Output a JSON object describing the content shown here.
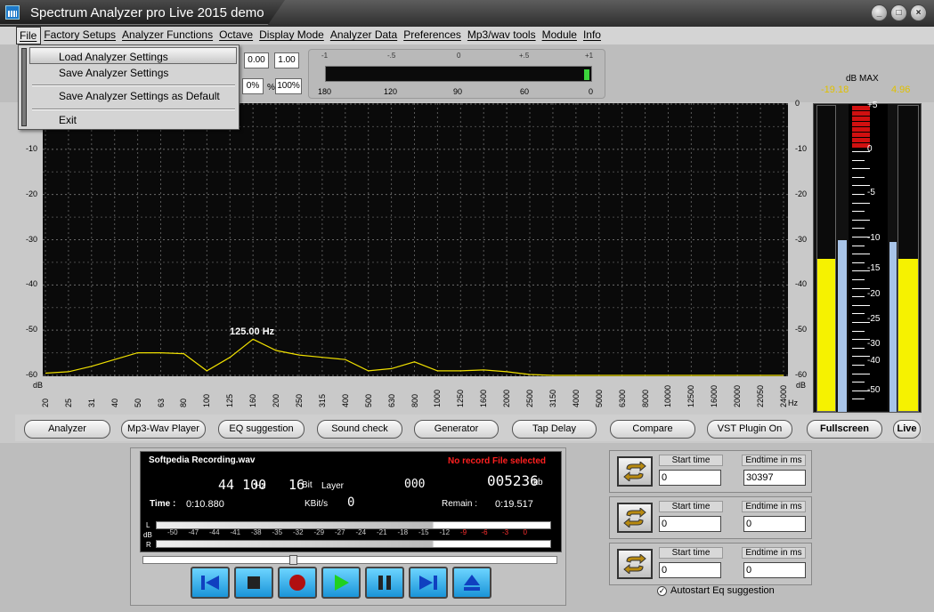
{
  "window": {
    "title": "Spectrum Analyzer pro Live 2015 demo",
    "buttons": [
      "_",
      "□",
      "×"
    ]
  },
  "menu": [
    "File",
    "Factory Setups",
    "Analyzer Functions",
    "Octave",
    "Display Mode",
    "Analyzer Data",
    "Preferences",
    "Mp3/wav tools",
    "Module",
    "Info"
  ],
  "file_menu": {
    "items": [
      "Load Analyzer Settings",
      "Save Analyzer Settings",
      "Save Analyzer Settings as Default",
      "Exit"
    ]
  },
  "toolbar": {
    "val_a": "0.00",
    "val_b": "1.00",
    "pct_a": "0%",
    "pct_sep": "%",
    "pct_b": "100%",
    "hmeter_ticks": [
      "-1",
      "-.5",
      "0",
      "+.5",
      "+1"
    ],
    "hmeter_labels": [
      "180",
      "120",
      "90",
      "60",
      "0"
    ],
    "hmeter_level": 0.98
  },
  "dbmax": {
    "label": "dB MAX",
    "left": "-19.18",
    "right": "4.96"
  },
  "chart_data": {
    "type": "line",
    "ylabel": "dB",
    "xlabel": "Hz",
    "ylim": [
      -60,
      0
    ],
    "yticks": [
      "0",
      "-10",
      "-20",
      "-30",
      "-40",
      "-50",
      "-60"
    ],
    "x": [
      "20",
      "25",
      "31",
      "40",
      "50",
      "63",
      "80",
      "100",
      "125",
      "160",
      "200",
      "250",
      "315",
      "400",
      "500",
      "630",
      "800",
      "1000",
      "1250",
      "1600",
      "2000",
      "2500",
      "3150",
      "4000",
      "5000",
      "6300",
      "8000",
      "10000",
      "12500",
      "16000",
      "20000",
      "22050",
      "24000"
    ],
    "series": [
      {
        "values": [
          -59.5,
          -59.2,
          -58,
          -56.5,
          -55,
          -55,
          -55.2,
          -59,
          -56,
          -52,
          -54.5,
          -55.5,
          -56,
          -56.5,
          -59,
          -58.5,
          -57,
          -59,
          -59,
          -58.8,
          -59.2,
          -59.8,
          -60,
          -60,
          -60,
          -60,
          -60,
          -60,
          -60,
          -60,
          -60,
          -60,
          -60
        ]
      }
    ],
    "peak_label": "125.00 Hz",
    "grid": true
  },
  "vu": {
    "scale": [
      "+5",
      "0",
      "-5",
      "-10",
      "-15",
      "-20",
      "-25",
      "-30",
      "-40",
      "-50"
    ],
    "left_level": 0.5,
    "left_peak": 0.6,
    "right_level": 0.5,
    "right_peak": 0.6
  },
  "module_buttons": [
    "Analyzer",
    "Mp3-Wav Player",
    "EQ suggestion",
    "Sound check",
    "Generator",
    "Tap Delay",
    "Compare",
    "VST Plugin On",
    "Fullscreen",
    "Live"
  ],
  "player": {
    "filename": "Softpedia Recording.wav",
    "status": "No record File selected",
    "rate": "44 100",
    "rate_unit": "Hz",
    "bits": "16",
    "bits_unit": "Bit",
    "layer_label": "Layer",
    "layer": "000",
    "size": "005236",
    "size_unit": "kb",
    "time_label": "Time :",
    "time": "0:10.880",
    "kbits_label": "KBit/s",
    "kbits": "0",
    "remain_label": "Remain :",
    "remain": "0:19.517",
    "l_label": "L",
    "db_label": "dB",
    "r_label": "R",
    "db_scale": [
      "-50",
      "-47",
      "-44",
      "-41",
      "-38",
      "-35",
      "-32",
      "-29",
      "-27",
      "-24",
      "-21",
      "-18",
      "-15",
      "-12",
      "-9",
      "-6",
      "-3",
      "0"
    ],
    "seek_position": 0.36
  },
  "eq_panels": [
    {
      "start_label": "Start time",
      "end_label": "Endtime in ms",
      "start": "0",
      "end": "30397"
    },
    {
      "start_label": "Start time",
      "end_label": "Endtime in ms",
      "start": "0",
      "end": "0"
    },
    {
      "start_label": "Start time",
      "end_label": "Endtime in ms",
      "start": "0",
      "end": "0"
    }
  ],
  "autostart": "Autostart Eq suggestion"
}
